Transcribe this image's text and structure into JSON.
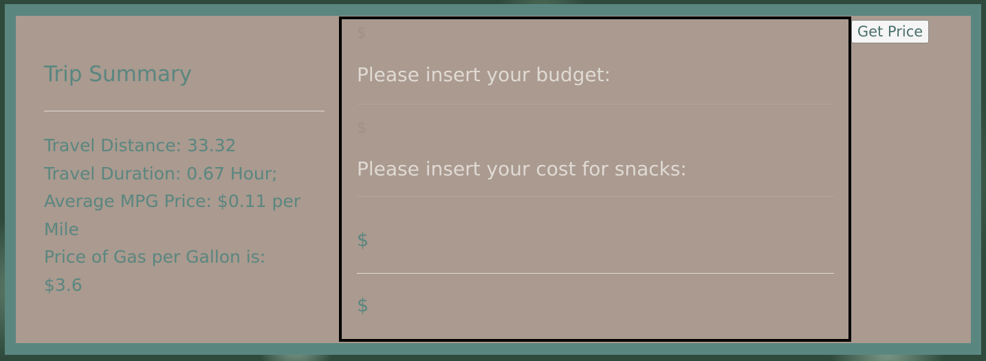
{
  "summary": {
    "title": "Trip Summary",
    "distance": "Travel Distance: 33.32",
    "duration": "Travel Duration: 0.67 Hour;",
    "mpg_price": "Average MPG Price: $0.11 per Mile",
    "gas_price": "Price of Gas per Gallon is: $3.6"
  },
  "form": {
    "budget_prefix": "$",
    "budget_label": "Please insert your budget:",
    "snacks_prefix": "$",
    "snacks_label": "Please insert your cost for snacks:",
    "result1": "$",
    "result2": "$"
  },
  "buttons": {
    "get_price": "Get Price"
  },
  "colors": {
    "frame": "#5a8680",
    "panel": "#aa9a8f",
    "accent_text": "#5a8680"
  }
}
